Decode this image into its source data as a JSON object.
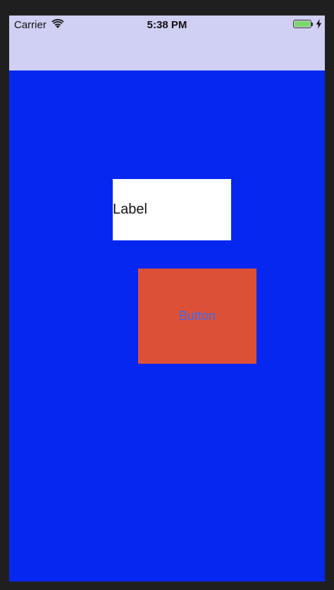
{
  "status_bar": {
    "carrier": "Carrier",
    "time": "5:38 PM",
    "wifi_icon": "wifi-icon",
    "battery_icon": "battery-icon",
    "charging_icon": "charging-bolt-icon"
  },
  "main": {
    "label_text": "Label",
    "button_text": "Button"
  },
  "colors": {
    "frame": "#1f1f1f",
    "navbar": "#d0d0f4",
    "background": "#0527f0",
    "label_bg": "#ffffff",
    "button_bg": "#dd5038",
    "button_text": "#3a6cf0",
    "battery_fill": "#7ed56b"
  }
}
